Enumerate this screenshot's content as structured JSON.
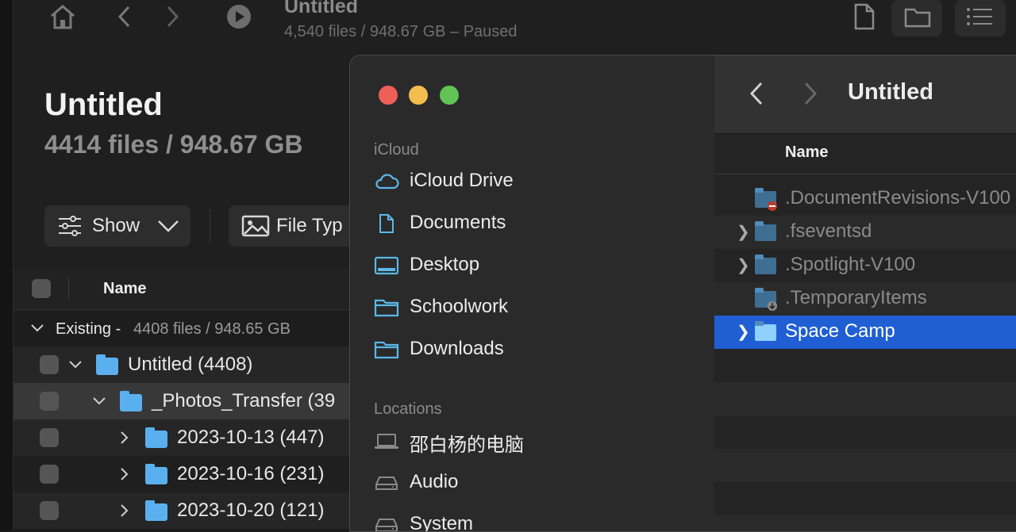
{
  "back_app": {
    "toolbar": {
      "title": "Untitled",
      "subtitle": "4,540 files / 948.67 GB – Paused"
    },
    "header": {
      "title": "Untitled",
      "subtitle": "4414 files / 948.67 GB",
      "show_label": "Show",
      "file_type_label": "File Typ"
    },
    "table": {
      "name_header": "Name",
      "group_label": "Existing - ",
      "group_count": "4408 files / 948.65 GB",
      "rows": [
        {
          "label": "Untitled (4408)"
        },
        {
          "label": "_Photos_Transfer (39"
        },
        {
          "label": "2023-10-13 (447)"
        },
        {
          "label": "2023-10-16 (231)"
        },
        {
          "label": "2023-10-20 (121)"
        }
      ]
    }
  },
  "finder": {
    "sidebar": {
      "icloud_header": "iCloud",
      "icloud_items": [
        {
          "label": "iCloud Drive",
          "icon": "cloud-icon"
        },
        {
          "label": "Documents",
          "icon": "document-icon"
        },
        {
          "label": "Desktop",
          "icon": "desktop-icon"
        },
        {
          "label": "Schoolwork",
          "icon": "folder-icon"
        },
        {
          "label": "Downloads",
          "icon": "folder-icon"
        }
      ],
      "locations_header": "Locations",
      "location_items": [
        {
          "label": "邵白杨的电脑",
          "icon": "laptop-icon"
        },
        {
          "label": "Audio",
          "icon": "drive-icon"
        },
        {
          "label": "System",
          "icon": "drive-icon"
        }
      ]
    },
    "main": {
      "title": "Untitled",
      "name_header": "Name",
      "rows": [
        {
          "name": ".DocumentRevisions-V100"
        },
        {
          "name": ".fseventsd"
        },
        {
          "name": ".Spotlight-V100"
        },
        {
          "name": ".TemporaryItems"
        },
        {
          "name": "Space Camp"
        }
      ]
    }
  },
  "colors": {
    "selection": "#1f5fd3",
    "folder": "#5ab0ee",
    "close": "#ee5f57",
    "minimize": "#f4bd4f",
    "zoom": "#61c454"
  }
}
